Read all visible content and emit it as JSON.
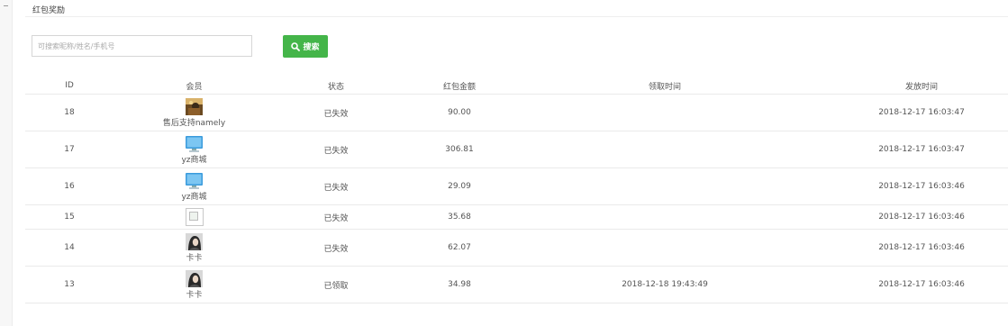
{
  "page": {
    "title": "红包奖励"
  },
  "search": {
    "placeholder": "可搜索昵称/姓名/手机号",
    "value": "",
    "button_label": "搜索"
  },
  "table": {
    "headers": {
      "id": "ID",
      "member": "会员",
      "status": "状态",
      "amount": "红包金额",
      "received_time": "领取时间",
      "sent_time": "发放时间"
    },
    "rows": [
      {
        "id": "18",
        "avatar": "photo-avatar",
        "member": "售后支持namely",
        "status": "已失效",
        "amount": "90.00",
        "received_time": "",
        "sent_time": "2018-12-17 16:03:47"
      },
      {
        "id": "17",
        "avatar": "monitor-avatar",
        "member": "yz商城",
        "status": "已失效",
        "amount": "306.81",
        "received_time": "",
        "sent_time": "2018-12-17 16:03:47"
      },
      {
        "id": "16",
        "avatar": "monitor-avatar",
        "member": "yz商城",
        "status": "已失效",
        "amount": "29.09",
        "received_time": "",
        "sent_time": "2018-12-17 16:03:46"
      },
      {
        "id": "15",
        "avatar": "broken-image",
        "member": "",
        "status": "已失效",
        "amount": "35.68",
        "received_time": "",
        "sent_time": "2018-12-17 16:03:46"
      },
      {
        "id": "14",
        "avatar": "portrait-avatar",
        "member": "卡卡",
        "status": "已失效",
        "amount": "62.07",
        "received_time": "",
        "sent_time": "2018-12-17 16:03:46"
      },
      {
        "id": "13",
        "avatar": "portrait-avatar",
        "member": "卡卡",
        "status": "已领取",
        "amount": "34.98",
        "received_time": "2018-12-18 19:43:49",
        "sent_time": "2018-12-17 16:03:46"
      }
    ]
  },
  "colors": {
    "accent": "#44b549",
    "divider": "#eaeaea",
    "text": "#555555"
  }
}
